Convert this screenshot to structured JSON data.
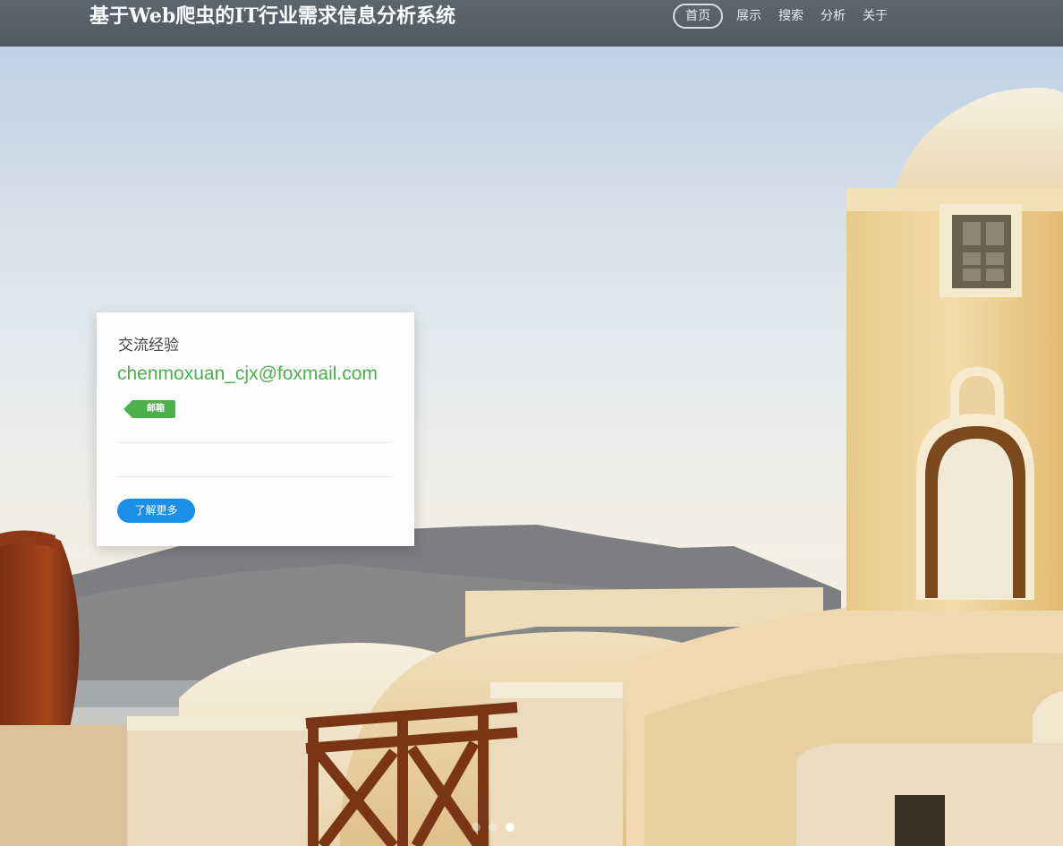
{
  "header": {
    "brand": "基于Web爬虫的IT行业需求信息分析系统"
  },
  "nav": {
    "items": [
      {
        "label": "首页",
        "active": true
      },
      {
        "label": "展示",
        "active": false
      },
      {
        "label": "搜索",
        "active": false
      },
      {
        "label": "分析",
        "active": false
      },
      {
        "label": "关于",
        "active": false
      }
    ]
  },
  "card": {
    "title": "交流经验",
    "email": "chenmoxuan_cjx@foxmail.com",
    "tag": "邮箱",
    "button": "了解更多"
  },
  "carousel": {
    "slide_count": 3,
    "active_index": 2
  },
  "colors": {
    "accent_green": "#4cb14a",
    "button_blue": "#1a8fe8",
    "navbar": "#525b64"
  }
}
